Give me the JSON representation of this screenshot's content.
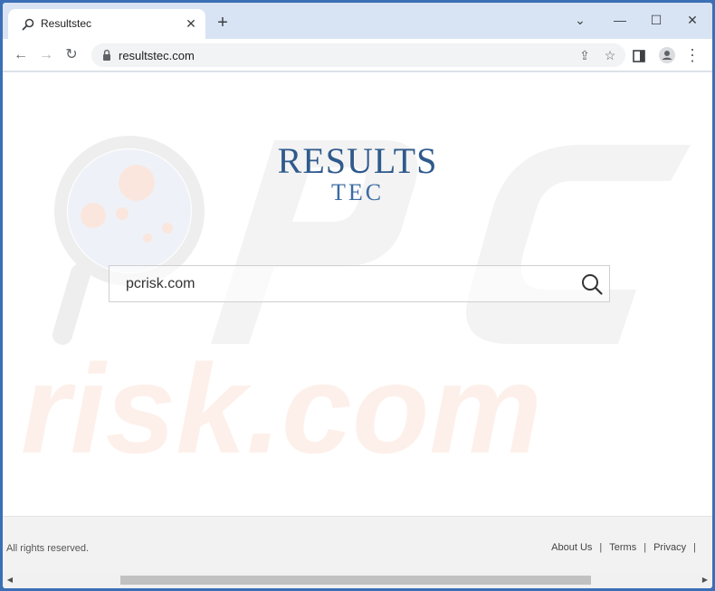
{
  "tab": {
    "title": "Resultstec",
    "favicon_icon": "search-icon",
    "close_icon": "close-icon"
  },
  "new_tab_icon": "plus-icon",
  "window_controls": [
    "chevron-down-icon",
    "minimize-icon",
    "maximize-icon",
    "close-icon"
  ],
  "toolbar": {
    "url": "resultstec.com",
    "buttons": [
      "back-arrow-icon",
      "forward-arrow-icon",
      "reload-icon"
    ],
    "omnibox_buttons": [
      "share-icon",
      "star-icon"
    ],
    "right_buttons": [
      "sidebar-icon",
      "profile-icon",
      "menu-dots-icon"
    ]
  },
  "logo": {
    "main": "RESULTS",
    "sub": "TEC"
  },
  "search": {
    "value": "pcrisk.com"
  },
  "footer": {
    "copyright": "All rights reserved.",
    "links": [
      "About Us",
      "Terms",
      "Privacy"
    ]
  },
  "colors": {
    "brand": "#2f5a8c",
    "window_border": "#3b6fb6",
    "tab_bar": "#d8e3f3"
  }
}
